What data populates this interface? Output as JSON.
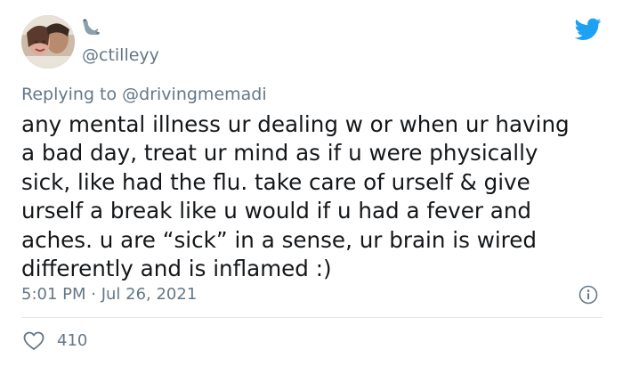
{
  "tweet": {
    "handle": "@ctilleyy",
    "reply_prefix": "Replying to ",
    "reply_to": "@drivingmemadi",
    "text": "any mental illness ur dealing w or when ur having\na bad day, treat ur mind as if u were physically\nsick, like had the flu. take care of urself & give\nurself a break like u would if u had a fever and\naches. u are “sick” in a sense, ur brain is wired\ndifferently and is inflamed :)",
    "timestamp": "5:01 PM · Jul 26, 2021",
    "like_count": "410"
  },
  "icons": {
    "name_emoji": "seal-emoji-icon",
    "brand": "twitter-bird-icon",
    "info": "info-icon",
    "like": "heart-icon"
  },
  "colors": {
    "brand": "#1da1f2",
    "secondary_text": "#657786",
    "primary_text": "#14171a",
    "divider": "#e1e8ed"
  }
}
